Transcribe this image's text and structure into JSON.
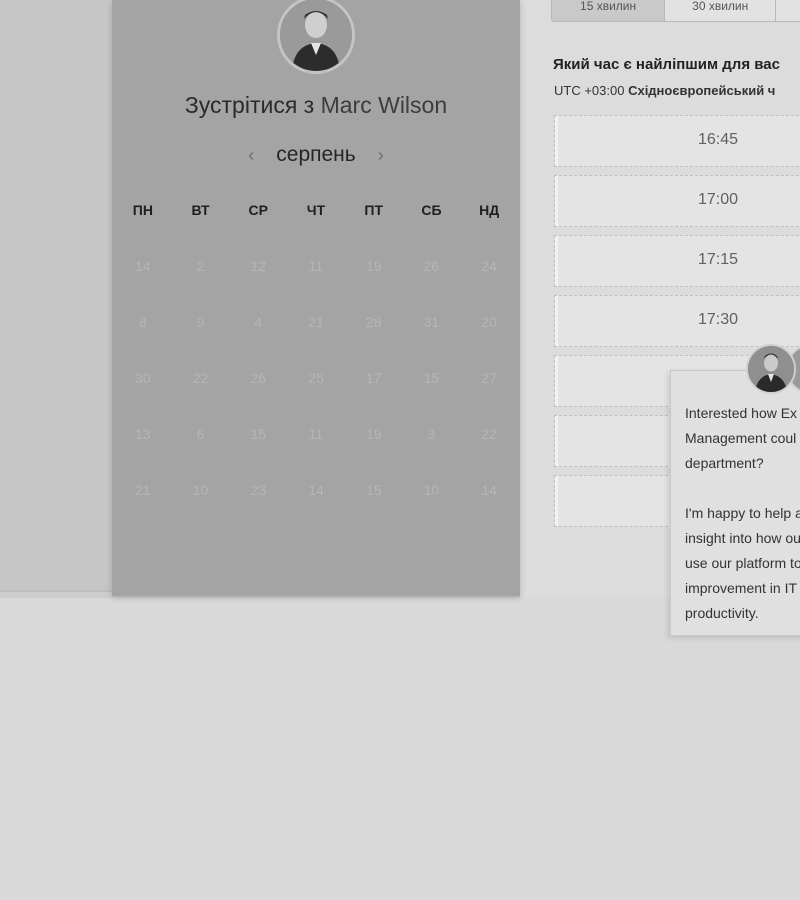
{
  "duration_tabs": [
    "15 хвилин",
    "30 хвилин",
    ""
  ],
  "meeting": {
    "title_prefix": "Зустрітися з",
    "host_name": "Marc Wilson"
  },
  "calendar": {
    "month": "серпень",
    "prev_icon": "chevron-left-icon",
    "next_icon": "chevron-right-icon",
    "weekdays": [
      "ПН",
      "ВТ",
      "СР",
      "ЧТ",
      "ПТ",
      "СБ",
      "НД"
    ],
    "weeks": [
      [
        "14",
        "2",
        "12",
        "11",
        "19",
        "26",
        "24"
      ],
      [
        "8",
        "9",
        "4",
        "21",
        "28",
        "31",
        "20"
      ],
      [
        "30",
        "22",
        "26",
        "25",
        "17",
        "15",
        "27"
      ],
      [
        "13",
        "6",
        "15",
        "11",
        "19",
        "3",
        "22"
      ],
      [
        "21",
        "10",
        "23",
        "14",
        "15",
        "10",
        "14"
      ]
    ]
  },
  "scheduler": {
    "question": "Який час є найліпшим для вас",
    "timezone_offset": "UTC +03:00",
    "timezone_name": "Східноєвропейський ч",
    "slots": [
      "16:45",
      "17:00",
      "17:15",
      "17:30",
      "",
      "",
      ""
    ]
  },
  "chat": {
    "message_lines_1": [
      "Interested how Ex",
      "Management coul",
      "department?"
    ],
    "message_lines_2": [
      "I'm happy to help a",
      "insight into how ou",
      "use our platform to",
      "improvement in IT",
      "productivity."
    ]
  }
}
